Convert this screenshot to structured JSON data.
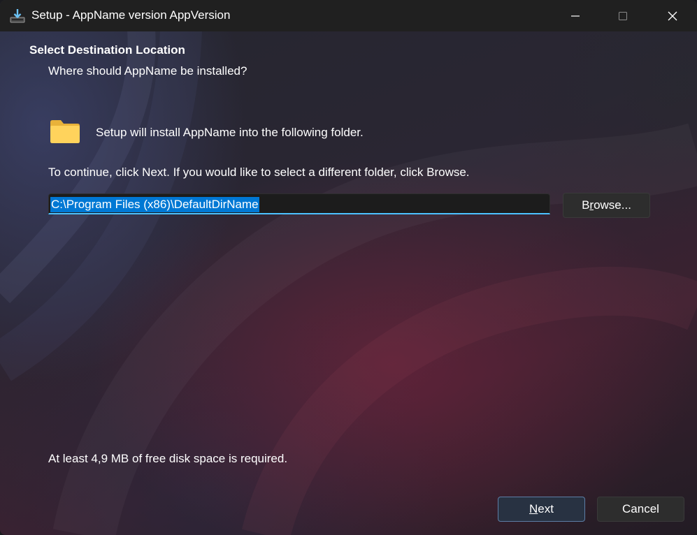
{
  "window": {
    "title": "Setup - AppName version AppVersion",
    "controls": {
      "minimize_icon": "minimize-icon",
      "maximize_icon": "maximize-icon",
      "close_icon": "close-icon"
    },
    "app_icon": "installer-download-icon"
  },
  "page": {
    "heading": "Select Destination Location",
    "subheading": "Where should AppName be installed?",
    "folder_icon": "folder-icon",
    "install_text": "Setup will install AppName into the following folder.",
    "continue_text": "To continue, click Next. If you would like to select a different folder, click Browse.",
    "path_value": "C:\\Program Files (x86)\\DefaultDirName",
    "browse_label_pre": "B",
    "browse_label_accel": "r",
    "browse_label_post": "owse...",
    "disk_space_text": "At least 4,9 MB of free disk space is required."
  },
  "footer": {
    "next_label_accel": "N",
    "next_label_post": "ext",
    "cancel_label": "Cancel"
  },
  "colors": {
    "accent": "#4cc2ff",
    "selection": "#0078d4",
    "titlebar": "#202020"
  }
}
